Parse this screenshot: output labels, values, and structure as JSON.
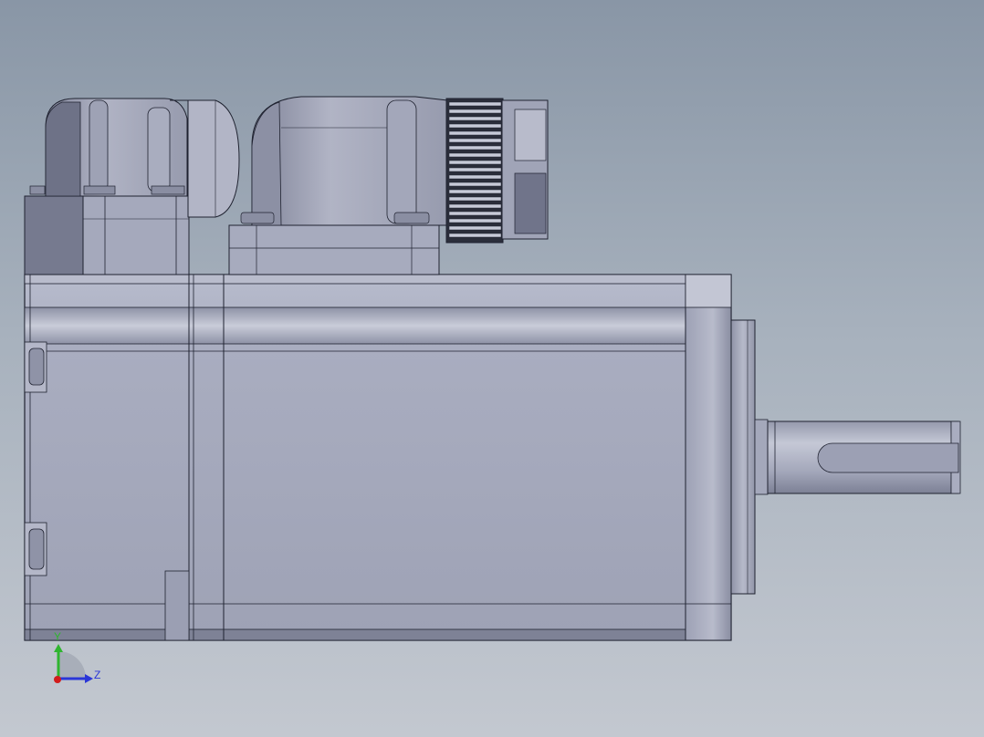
{
  "viewport": {
    "background_top": "#8996a6",
    "background_bottom": "#c3c8d0",
    "model_color": "#a2a6ba",
    "edge_color": "#1f2230"
  },
  "triad": {
    "y_label": "Y",
    "z_label": "Z",
    "y_color": "#2fb52f",
    "z_color": "#2a36d8",
    "x_color": "#d21c1c"
  }
}
